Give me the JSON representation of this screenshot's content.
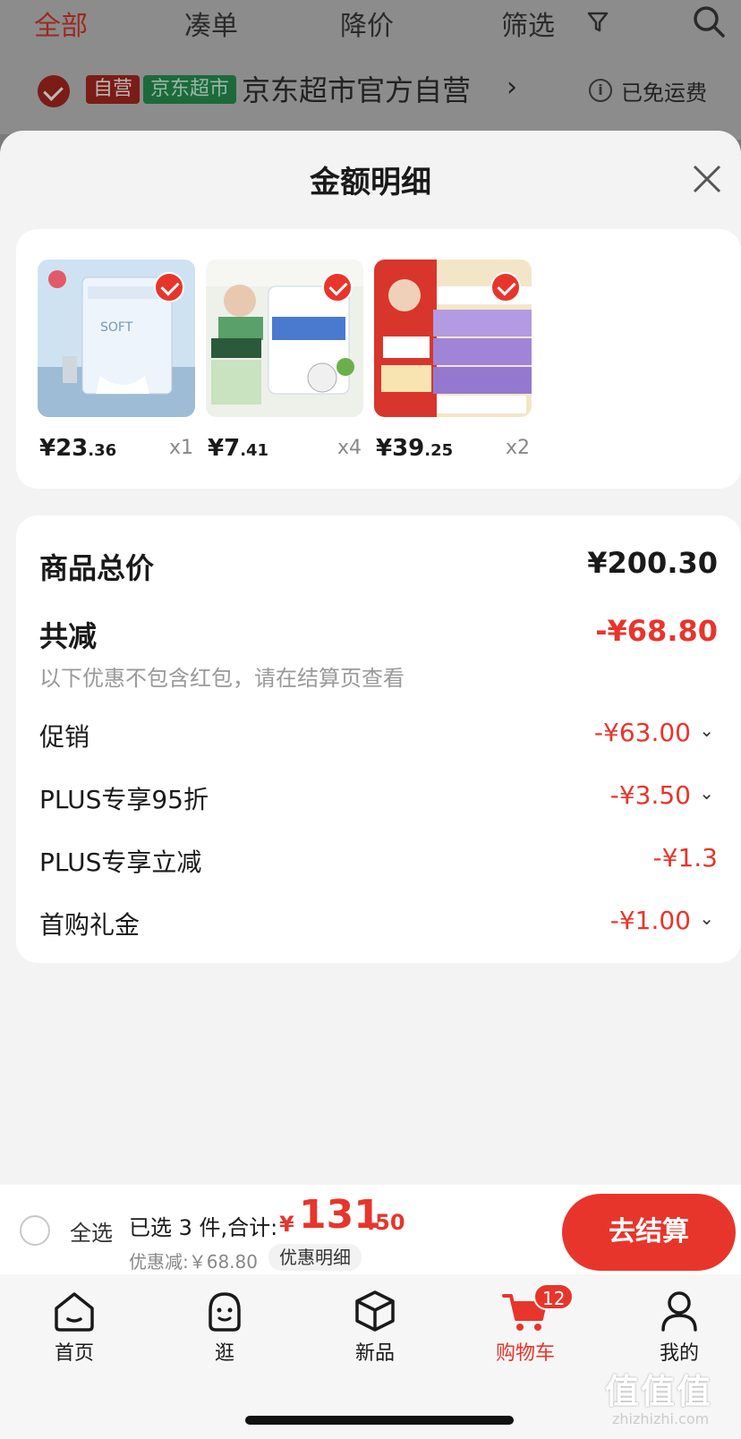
{
  "background": {
    "tabs": [
      "全部",
      "凑单",
      "降价",
      "筛选"
    ],
    "store": {
      "tag_self": "自营",
      "tag_jd": "京东超市",
      "name": "京东超市官方自营",
      "chevron": "›",
      "info_icon": "i",
      "shipping": "已免运费"
    }
  },
  "sheet": {
    "title": "金额明细",
    "products": [
      {
        "price_int": "¥23",
        "price_dec": ".36",
        "qty": "x1",
        "img": "tissue-box"
      },
      {
        "price_int": "¥7",
        "price_dec": ".41",
        "qty": "x4",
        "img": "kitchen-paper"
      },
      {
        "price_int": "¥39",
        "price_dec": ".25",
        "qty": "x2",
        "img": "tissue-promo"
      }
    ],
    "summary": {
      "total_label": "商品总价",
      "total_value": "¥200.30",
      "reduce_label": "共减",
      "reduce_value": "-¥68.80",
      "note": "以下优惠不包含红包，请在结算页查看",
      "items": [
        {
          "label": "促销",
          "value": "-¥63.00",
          "chevron": "⌄"
        },
        {
          "label": "PLUS专享95折",
          "value": "-¥3.50",
          "chevron": "⌄"
        },
        {
          "label": "PLUS专享立减",
          "value": "-¥1.3",
          "chevron": ""
        },
        {
          "label": "首购礼金",
          "value": "-¥1.00",
          "chevron": "⌄"
        }
      ]
    }
  },
  "checkout": {
    "select_all": "全选",
    "selected": "已选 3 件,合计:",
    "yen": "¥",
    "total_int": "131",
    "total_dec": ".50",
    "discount": "优惠减:￥68.80",
    "detail_chip": "优惠明细",
    "button": "去结算"
  },
  "nav": {
    "items": [
      {
        "label": "首页",
        "icon": "home-icon"
      },
      {
        "label": "逛",
        "icon": "face-icon"
      },
      {
        "label": "新品",
        "icon": "box-icon"
      },
      {
        "label": "购物车",
        "icon": "cart-icon"
      },
      {
        "label": "我的",
        "icon": "user-icon"
      }
    ],
    "cart_badge": "12"
  },
  "watermark": {
    "text": "值值值",
    "url": "zhizhizhi.com"
  },
  "colors": {
    "accent": "#e8352b",
    "sheet_bg": "#f3f3f3"
  }
}
